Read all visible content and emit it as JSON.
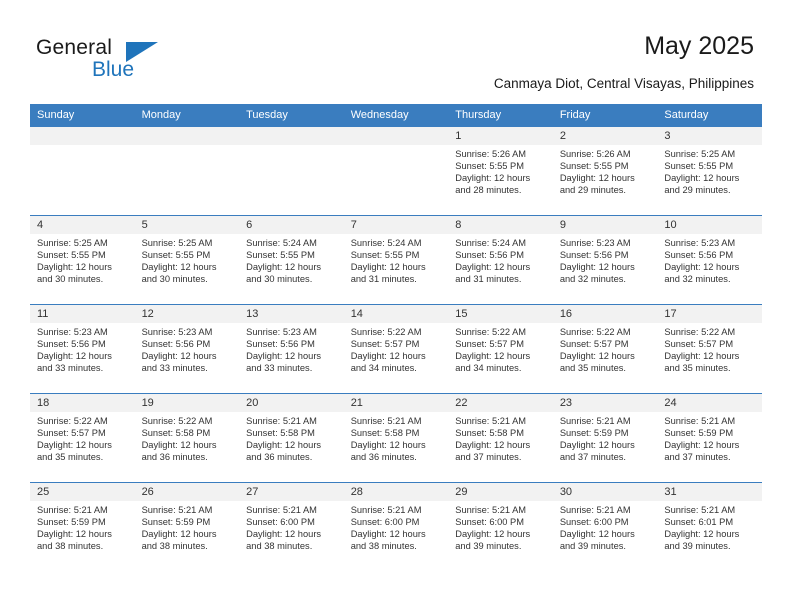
{
  "brand": {
    "name_part1": "General",
    "name_part2": "Blue",
    "accent_color": "#1f74bb",
    "logo_icon": "triangle-sail-icon"
  },
  "header": {
    "title": "May 2025",
    "subtitle": "Canmaya Diot, Central Visayas, Philippines"
  },
  "colors": {
    "header_row_bg": "#3a7dbf",
    "day_number_bg": "#f2f2f2",
    "text": "#333333"
  },
  "calendar": {
    "weekday_headers": [
      "Sunday",
      "Monday",
      "Tuesday",
      "Wednesday",
      "Thursday",
      "Friday",
      "Saturday"
    ],
    "labels": {
      "sunrise": "Sunrise:",
      "sunset": "Sunset:",
      "daylight": "Daylight:"
    },
    "weeks": [
      [
        {
          "day": "",
          "empty": true
        },
        {
          "day": "",
          "empty": true
        },
        {
          "day": "",
          "empty": true
        },
        {
          "day": "",
          "empty": true
        },
        {
          "day": "1",
          "sunrise": "Sunrise: 5:26 AM",
          "sunset": "Sunset: 5:55 PM",
          "daylight_line1": "Daylight: 12 hours",
          "daylight_line2": "and 28 minutes."
        },
        {
          "day": "2",
          "sunrise": "Sunrise: 5:26 AM",
          "sunset": "Sunset: 5:55 PM",
          "daylight_line1": "Daylight: 12 hours",
          "daylight_line2": "and 29 minutes."
        },
        {
          "day": "3",
          "sunrise": "Sunrise: 5:25 AM",
          "sunset": "Sunset: 5:55 PM",
          "daylight_line1": "Daylight: 12 hours",
          "daylight_line2": "and 29 minutes."
        }
      ],
      [
        {
          "day": "4",
          "sunrise": "Sunrise: 5:25 AM",
          "sunset": "Sunset: 5:55 PM",
          "daylight_line1": "Daylight: 12 hours",
          "daylight_line2": "and 30 minutes."
        },
        {
          "day": "5",
          "sunrise": "Sunrise: 5:25 AM",
          "sunset": "Sunset: 5:55 PM",
          "daylight_line1": "Daylight: 12 hours",
          "daylight_line2": "and 30 minutes."
        },
        {
          "day": "6",
          "sunrise": "Sunrise: 5:24 AM",
          "sunset": "Sunset: 5:55 PM",
          "daylight_line1": "Daylight: 12 hours",
          "daylight_line2": "and 30 minutes."
        },
        {
          "day": "7",
          "sunrise": "Sunrise: 5:24 AM",
          "sunset": "Sunset: 5:55 PM",
          "daylight_line1": "Daylight: 12 hours",
          "daylight_line2": "and 31 minutes."
        },
        {
          "day": "8",
          "sunrise": "Sunrise: 5:24 AM",
          "sunset": "Sunset: 5:56 PM",
          "daylight_line1": "Daylight: 12 hours",
          "daylight_line2": "and 31 minutes."
        },
        {
          "day": "9",
          "sunrise": "Sunrise: 5:23 AM",
          "sunset": "Sunset: 5:56 PM",
          "daylight_line1": "Daylight: 12 hours",
          "daylight_line2": "and 32 minutes."
        },
        {
          "day": "10",
          "sunrise": "Sunrise: 5:23 AM",
          "sunset": "Sunset: 5:56 PM",
          "daylight_line1": "Daylight: 12 hours",
          "daylight_line2": "and 32 minutes."
        }
      ],
      [
        {
          "day": "11",
          "sunrise": "Sunrise: 5:23 AM",
          "sunset": "Sunset: 5:56 PM",
          "daylight_line1": "Daylight: 12 hours",
          "daylight_line2": "and 33 minutes."
        },
        {
          "day": "12",
          "sunrise": "Sunrise: 5:23 AM",
          "sunset": "Sunset: 5:56 PM",
          "daylight_line1": "Daylight: 12 hours",
          "daylight_line2": "and 33 minutes."
        },
        {
          "day": "13",
          "sunrise": "Sunrise: 5:23 AM",
          "sunset": "Sunset: 5:56 PM",
          "daylight_line1": "Daylight: 12 hours",
          "daylight_line2": "and 33 minutes."
        },
        {
          "day": "14",
          "sunrise": "Sunrise: 5:22 AM",
          "sunset": "Sunset: 5:57 PM",
          "daylight_line1": "Daylight: 12 hours",
          "daylight_line2": "and 34 minutes."
        },
        {
          "day": "15",
          "sunrise": "Sunrise: 5:22 AM",
          "sunset": "Sunset: 5:57 PM",
          "daylight_line1": "Daylight: 12 hours",
          "daylight_line2": "and 34 minutes."
        },
        {
          "day": "16",
          "sunrise": "Sunrise: 5:22 AM",
          "sunset": "Sunset: 5:57 PM",
          "daylight_line1": "Daylight: 12 hours",
          "daylight_line2": "and 35 minutes."
        },
        {
          "day": "17",
          "sunrise": "Sunrise: 5:22 AM",
          "sunset": "Sunset: 5:57 PM",
          "daylight_line1": "Daylight: 12 hours",
          "daylight_line2": "and 35 minutes."
        }
      ],
      [
        {
          "day": "18",
          "sunrise": "Sunrise: 5:22 AM",
          "sunset": "Sunset: 5:57 PM",
          "daylight_line1": "Daylight: 12 hours",
          "daylight_line2": "and 35 minutes."
        },
        {
          "day": "19",
          "sunrise": "Sunrise: 5:22 AM",
          "sunset": "Sunset: 5:58 PM",
          "daylight_line1": "Daylight: 12 hours",
          "daylight_line2": "and 36 minutes."
        },
        {
          "day": "20",
          "sunrise": "Sunrise: 5:21 AM",
          "sunset": "Sunset: 5:58 PM",
          "daylight_line1": "Daylight: 12 hours",
          "daylight_line2": "and 36 minutes."
        },
        {
          "day": "21",
          "sunrise": "Sunrise: 5:21 AM",
          "sunset": "Sunset: 5:58 PM",
          "daylight_line1": "Daylight: 12 hours",
          "daylight_line2": "and 36 minutes."
        },
        {
          "day": "22",
          "sunrise": "Sunrise: 5:21 AM",
          "sunset": "Sunset: 5:58 PM",
          "daylight_line1": "Daylight: 12 hours",
          "daylight_line2": "and 37 minutes."
        },
        {
          "day": "23",
          "sunrise": "Sunrise: 5:21 AM",
          "sunset": "Sunset: 5:59 PM",
          "daylight_line1": "Daylight: 12 hours",
          "daylight_line2": "and 37 minutes."
        },
        {
          "day": "24",
          "sunrise": "Sunrise: 5:21 AM",
          "sunset": "Sunset: 5:59 PM",
          "daylight_line1": "Daylight: 12 hours",
          "daylight_line2": "and 37 minutes."
        }
      ],
      [
        {
          "day": "25",
          "sunrise": "Sunrise: 5:21 AM",
          "sunset": "Sunset: 5:59 PM",
          "daylight_line1": "Daylight: 12 hours",
          "daylight_line2": "and 38 minutes."
        },
        {
          "day": "26",
          "sunrise": "Sunrise: 5:21 AM",
          "sunset": "Sunset: 5:59 PM",
          "daylight_line1": "Daylight: 12 hours",
          "daylight_line2": "and 38 minutes."
        },
        {
          "day": "27",
          "sunrise": "Sunrise: 5:21 AM",
          "sunset": "Sunset: 6:00 PM",
          "daylight_line1": "Daylight: 12 hours",
          "daylight_line2": "and 38 minutes."
        },
        {
          "day": "28",
          "sunrise": "Sunrise: 5:21 AM",
          "sunset": "Sunset: 6:00 PM",
          "daylight_line1": "Daylight: 12 hours",
          "daylight_line2": "and 38 minutes."
        },
        {
          "day": "29",
          "sunrise": "Sunrise: 5:21 AM",
          "sunset": "Sunset: 6:00 PM",
          "daylight_line1": "Daylight: 12 hours",
          "daylight_line2": "and 39 minutes."
        },
        {
          "day": "30",
          "sunrise": "Sunrise: 5:21 AM",
          "sunset": "Sunset: 6:00 PM",
          "daylight_line1": "Daylight: 12 hours",
          "daylight_line2": "and 39 minutes."
        },
        {
          "day": "31",
          "sunrise": "Sunrise: 5:21 AM",
          "sunset": "Sunset: 6:01 PM",
          "daylight_line1": "Daylight: 12 hours",
          "daylight_line2": "and 39 minutes."
        }
      ]
    ]
  }
}
